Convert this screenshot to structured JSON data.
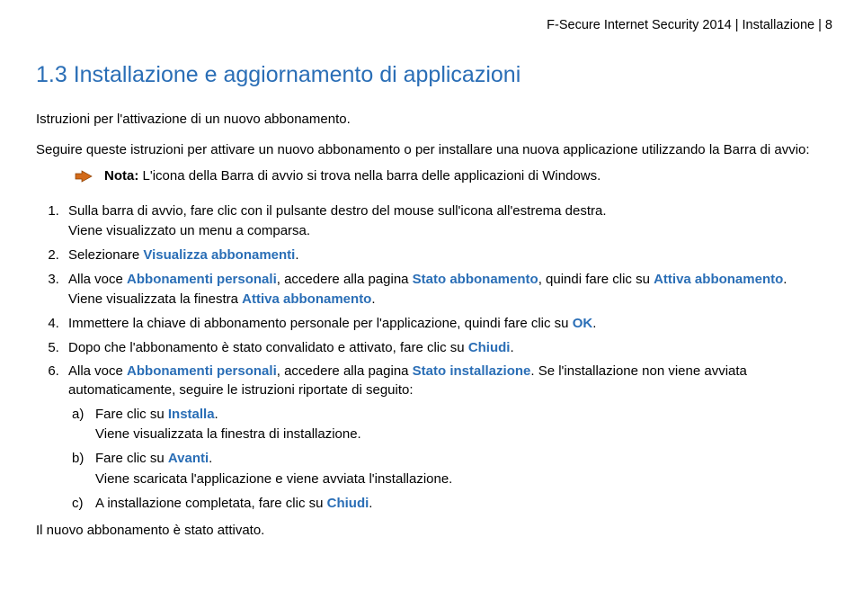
{
  "header": "F-Secure Internet Security 2014 | Installazione | 8",
  "title": "1.3 Installazione e aggiornamento di applicazioni",
  "intro": "Istruzioni per l'attivazione di un nuovo abbonamento.",
  "lead": "Seguire queste istruzioni per attivare un nuovo abbonamento o per installare una nuova applicazione utilizzando la Barra di avvio:",
  "note": {
    "label": "Nota:",
    "text": "L'icona della Barra di avvio si trova nella barra delle applicazioni di Windows."
  },
  "steps": {
    "s1_a": "Sulla barra di avvio, fare clic con il pulsante destro del mouse sull'icona all'estrema destra.",
    "s1_b": "Viene visualizzato un menu a comparsa.",
    "s2_a": "Selezionare ",
    "s2_hl": "Visualizza abbonamenti",
    "s2_b": ".",
    "s3_a": "Alla voce ",
    "s3_hl1": "Abbonamenti personali",
    "s3_b": ", accedere alla pagina ",
    "s3_hl2": "Stato abbonamento",
    "s3_c": ", quindi fare clic su ",
    "s3_hl3": "Attiva abbonamento",
    "s3_d": ".",
    "s3_sub_a": "Viene visualizzata la finestra ",
    "s3_sub_hl": "Attiva abbonamento",
    "s3_sub_b": ".",
    "s4_a": "Immettere la chiave di abbonamento personale per l'applicazione, quindi fare clic su ",
    "s4_hl": "OK",
    "s4_b": ".",
    "s5_a": "Dopo che l'abbonamento è stato convalidato e attivato, fare clic su ",
    "s5_hl": "Chiudi",
    "s5_b": ".",
    "s6_a": "Alla voce ",
    "s6_hl1": "Abbonamenti personali",
    "s6_b": ", accedere alla pagina ",
    "s6_hl2": "Stato installazione",
    "s6_c": ". Se l'installazione non viene avviata automaticamente, seguire le istruzioni riportate di seguito:",
    "s6a_a": "Fare clic su ",
    "s6a_hl": "Installa",
    "s6a_b": ".",
    "s6a_sub": "Viene visualizzata la finestra di installazione.",
    "s6b_a": "Fare clic su ",
    "s6b_hl": "Avanti",
    "s6b_b": ".",
    "s6b_sub": "Viene scaricata l'applicazione e viene avviata l'installazione.",
    "s6c_a": "A installazione completata, fare clic su ",
    "s6c_hl": "Chiudi",
    "s6c_b": "."
  },
  "closing": "Il nuovo abbonamento è stato attivato."
}
